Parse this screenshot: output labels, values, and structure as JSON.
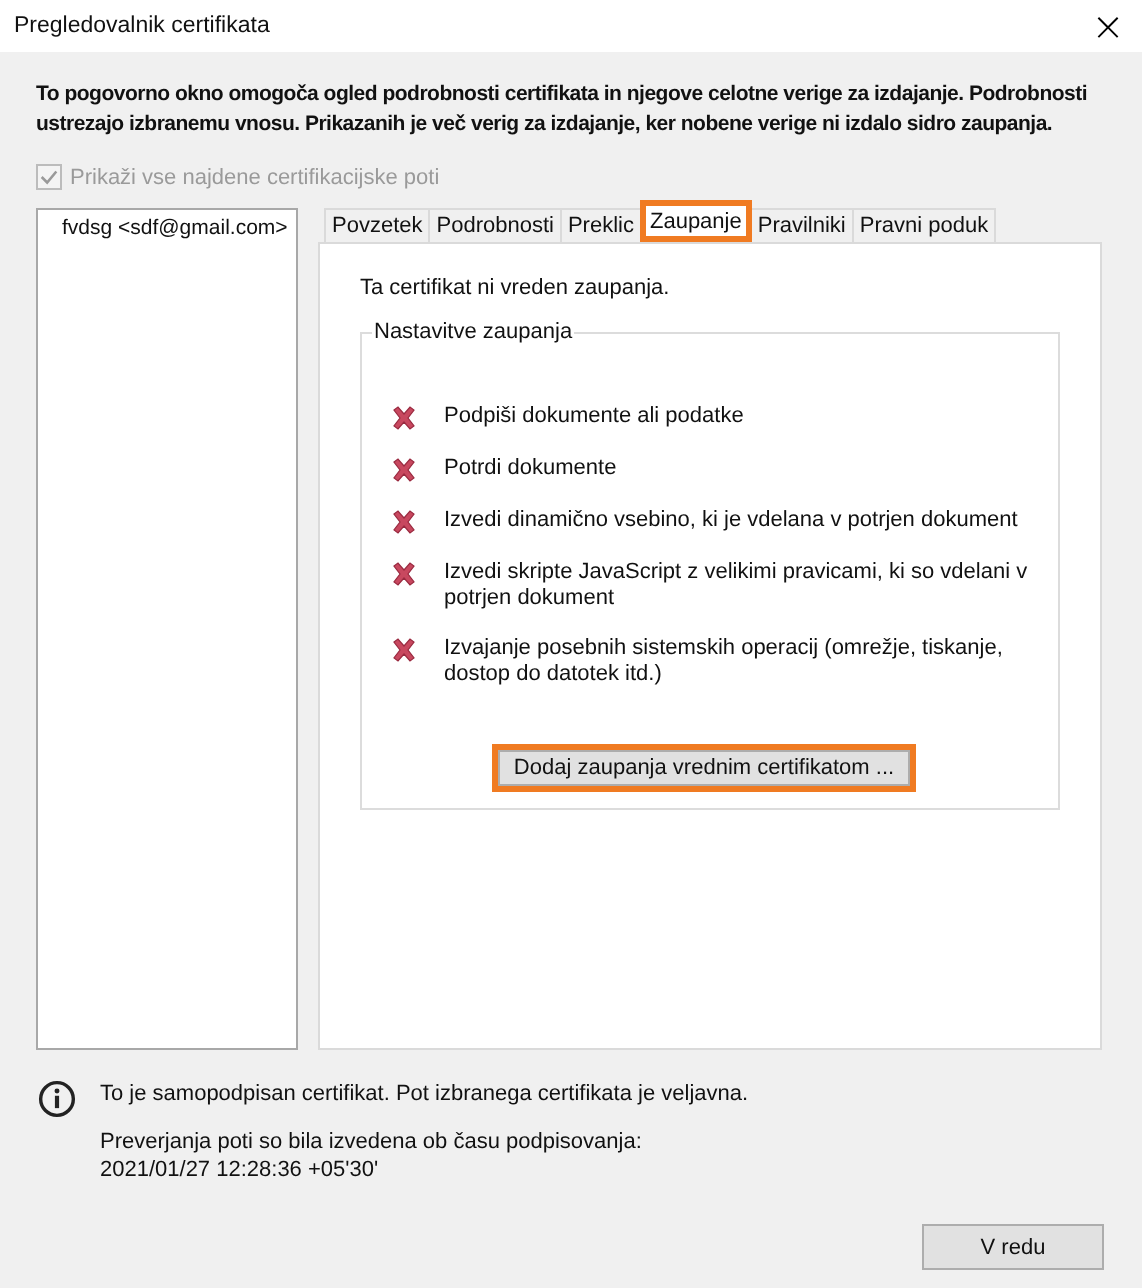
{
  "window": {
    "title": "Pregledovalnik certifikata",
    "close": "×"
  },
  "description": "To pogovorno okno omogoča ogled podrobnosti certifikata in njegove celotne verige za izdajanje. Podrobnosti ustrezajo izbranemu vnosu. Prikazanih je več verig za izdajanje, ker nobene verige ni izdalo sidro zaupanja.",
  "show_all_paths": {
    "label": "Prikaži vse najdene certifikacijske poti",
    "checked": true,
    "disabled": true
  },
  "certificates": [
    {
      "label": "fvdsg <sdf@gmail.com>",
      "selected": false
    }
  ],
  "tabs": [
    {
      "label": "Povzetek",
      "selected": false,
      "highlighted": false
    },
    {
      "label": "Podrobnosti",
      "selected": false,
      "highlighted": false
    },
    {
      "label": "Preklic",
      "selected": false,
      "highlighted": false
    },
    {
      "label": "Zaupanje",
      "selected": true,
      "highlighted": true
    },
    {
      "label": "Pravilniki",
      "selected": false,
      "highlighted": false
    },
    {
      "label": "Pravni poduk",
      "selected": false,
      "highlighted": false
    }
  ],
  "trust": {
    "status": "Ta certifikat ni vreden zaupanja.",
    "group_title": "Nastavitve zaupanja",
    "items": [
      {
        "label": "Podpiši dokumente ali podatke",
        "allowed": false
      },
      {
        "label": "Potrdi dokumente",
        "allowed": false
      },
      {
        "label": "Izvedi dinamično vsebino, ki je vdelana v potrjen dokument",
        "allowed": false
      },
      {
        "label": "Izvedi skripte JavaScript z velikimi pravicami, ki so vdelani v potrjen dokument",
        "allowed": false
      },
      {
        "label": "Izvajanje posebnih sistemskih operacij (omrežje, tiskanje, dostop do datotek itd.)",
        "allowed": false
      }
    ],
    "button": {
      "label": "Dodaj zaupanja vrednim certifikatom ...",
      "highlighted": true
    }
  },
  "info": {
    "message": "To je samopodpisan certifikat. Pot izbranega certifikata je veljavna.",
    "validation": "Preverjanja poti so bila izvedena ob času podpisovanja:",
    "timestamp": "2021/01/27 12:28:36 +05'30'"
  },
  "ok_button": "V redu"
}
